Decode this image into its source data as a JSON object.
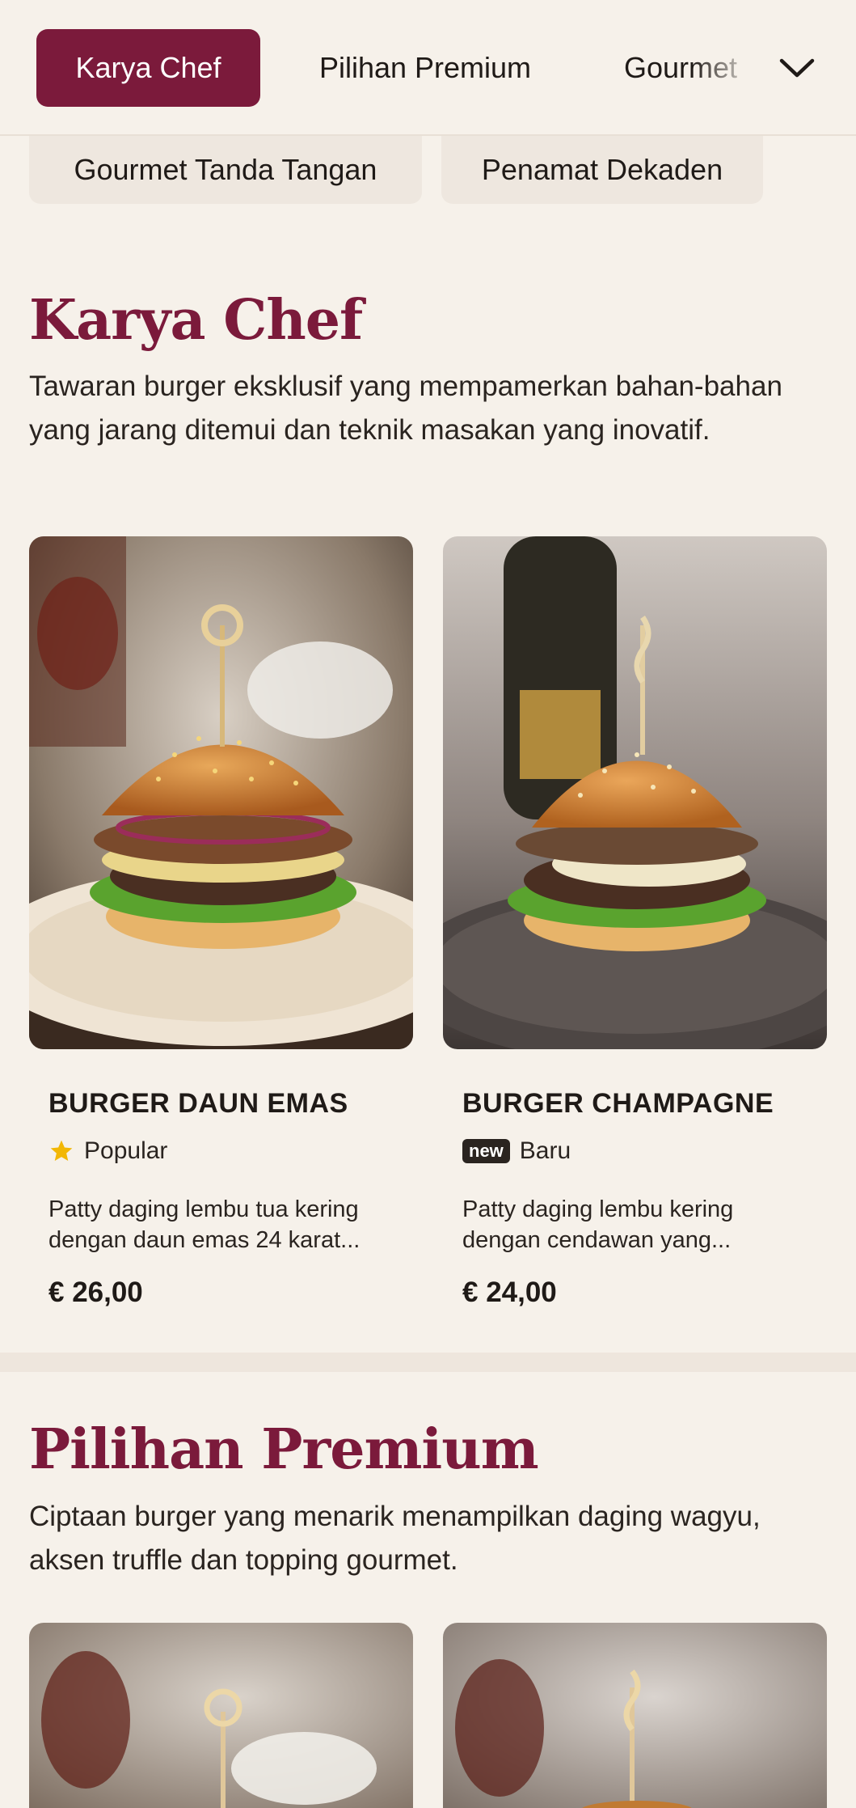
{
  "nav": {
    "tabs": [
      "Karya Chef",
      "Pilihan Premium",
      "Gourmet"
    ],
    "chips": [
      "Gourmet Tanda Tangan",
      "Penamat Dekaden"
    ]
  },
  "sections": [
    {
      "title": "Karya Chef",
      "desc": "Tawaran burger eksklusif yang mempamerkan bahan-bahan yang jarang ditemui dan teknik masakan yang inovatif.",
      "items": [
        {
          "name": "BURGER DAUN EMAS",
          "tag": "Popular",
          "desc": "Patty daging lembu tua kering dengan daun emas 24 karat...",
          "price": "€ 26,00"
        },
        {
          "name": "BURGER CHAMPAGNE",
          "badge": "new",
          "tag": "Baru",
          "desc": "Patty daging lembu kering dengan cendawan yang...",
          "price": "€ 24,00"
        }
      ]
    },
    {
      "title": "Pilihan Premium",
      "desc": "Ciptaan burger yang menarik menampilkan daging wagyu, aksen truffle dan topping gourmet."
    }
  ],
  "colors": {
    "accent": "#7b1a3b",
    "background": "#f6f1ea",
    "star": "#f2b705"
  }
}
